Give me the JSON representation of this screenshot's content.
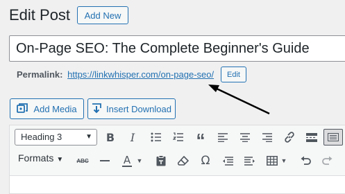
{
  "header": {
    "title": "Edit Post",
    "add_new_label": "Add New"
  },
  "post": {
    "title": "On-Page SEO: The Complete Beginner's Guide"
  },
  "permalink": {
    "label": "Permalink:",
    "url": "https://linkwhisper.com/on-page-seo/",
    "edit_label": "Edit"
  },
  "media_buttons": {
    "add_media_label": "Add Media",
    "insert_download_label": "Insert Download"
  },
  "toolbar": {
    "format_select_value": "Heading 3",
    "formats_label": "Formats",
    "row1_icons": [
      "bold-icon",
      "italic-icon",
      "bullet-list-icon",
      "numbered-list-icon",
      "blockquote-icon",
      "align-left-icon",
      "align-center-icon",
      "align-right-icon",
      "link-icon",
      "read-more-icon",
      "toolbar-toggle-icon"
    ],
    "row2_icons": [
      "strikethrough-icon",
      "horizontal-line-icon",
      "text-color-icon",
      "paste-as-text-icon",
      "clear-formatting-icon",
      "special-character-icon",
      "outdent-icon",
      "indent-icon",
      "table-icon",
      "undo-icon",
      "redo-icon"
    ]
  },
  "annotation": {
    "arrow_color": "#000000"
  },
  "colors": {
    "accent": "#2271b1",
    "text": "#1d2327",
    "icon": "#50575e",
    "background": "#f0f0f1"
  }
}
